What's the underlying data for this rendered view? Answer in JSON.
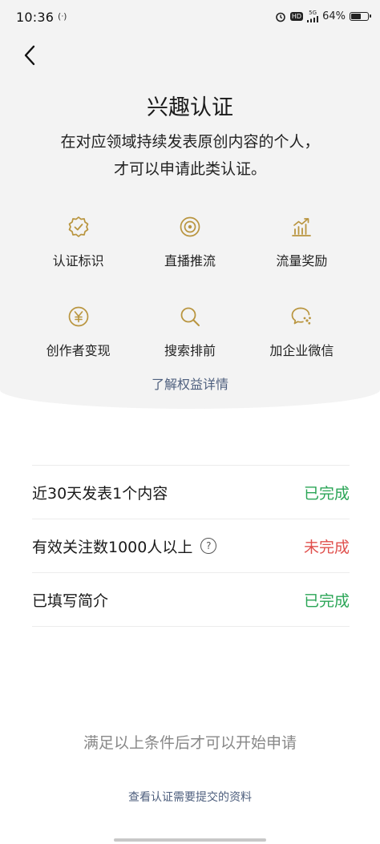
{
  "status_bar": {
    "time": "10:36",
    "nfc": "(ᐧ)",
    "hd": "HD",
    "network": "5G",
    "battery_text": "64%",
    "battery_level": 0.64
  },
  "header": {
    "title": "兴趣认证",
    "subtitle_line1": "在对应领域持续发表原创内容的个人，",
    "subtitle_line2": "才可以申请此类认证。"
  },
  "benefits": [
    {
      "label": "认证标识",
      "icon": "badge-check-icon"
    },
    {
      "label": "直播推流",
      "icon": "live-broadcast-icon"
    },
    {
      "label": "流量奖励",
      "icon": "traffic-chart-icon"
    },
    {
      "label": "创作者变现",
      "icon": "yuan-coin-icon"
    },
    {
      "label": "搜索排前",
      "icon": "search-icon"
    },
    {
      "label": "加企业微信",
      "icon": "wecom-chat-icon"
    }
  ],
  "learn_more": "了解权益详情",
  "requirements": [
    {
      "label": "近30天发表1个内容",
      "status": "已完成",
      "done": true,
      "help": false
    },
    {
      "label": "有效关注数1000人以上",
      "status": "未完成",
      "done": false,
      "help": true
    },
    {
      "label": "已填写简介",
      "status": "已完成",
      "done": true,
      "help": false
    }
  ],
  "help_symbol": "?",
  "condition_text": "满足以上条件后才可以开始申请",
  "materials_link": "查看认证需要提交的资料",
  "colors": {
    "accent_gold": "#b9953f",
    "complete_green": "#2aa556",
    "incomplete_red": "#e0504d",
    "link_blue": "#4e5f7e"
  }
}
